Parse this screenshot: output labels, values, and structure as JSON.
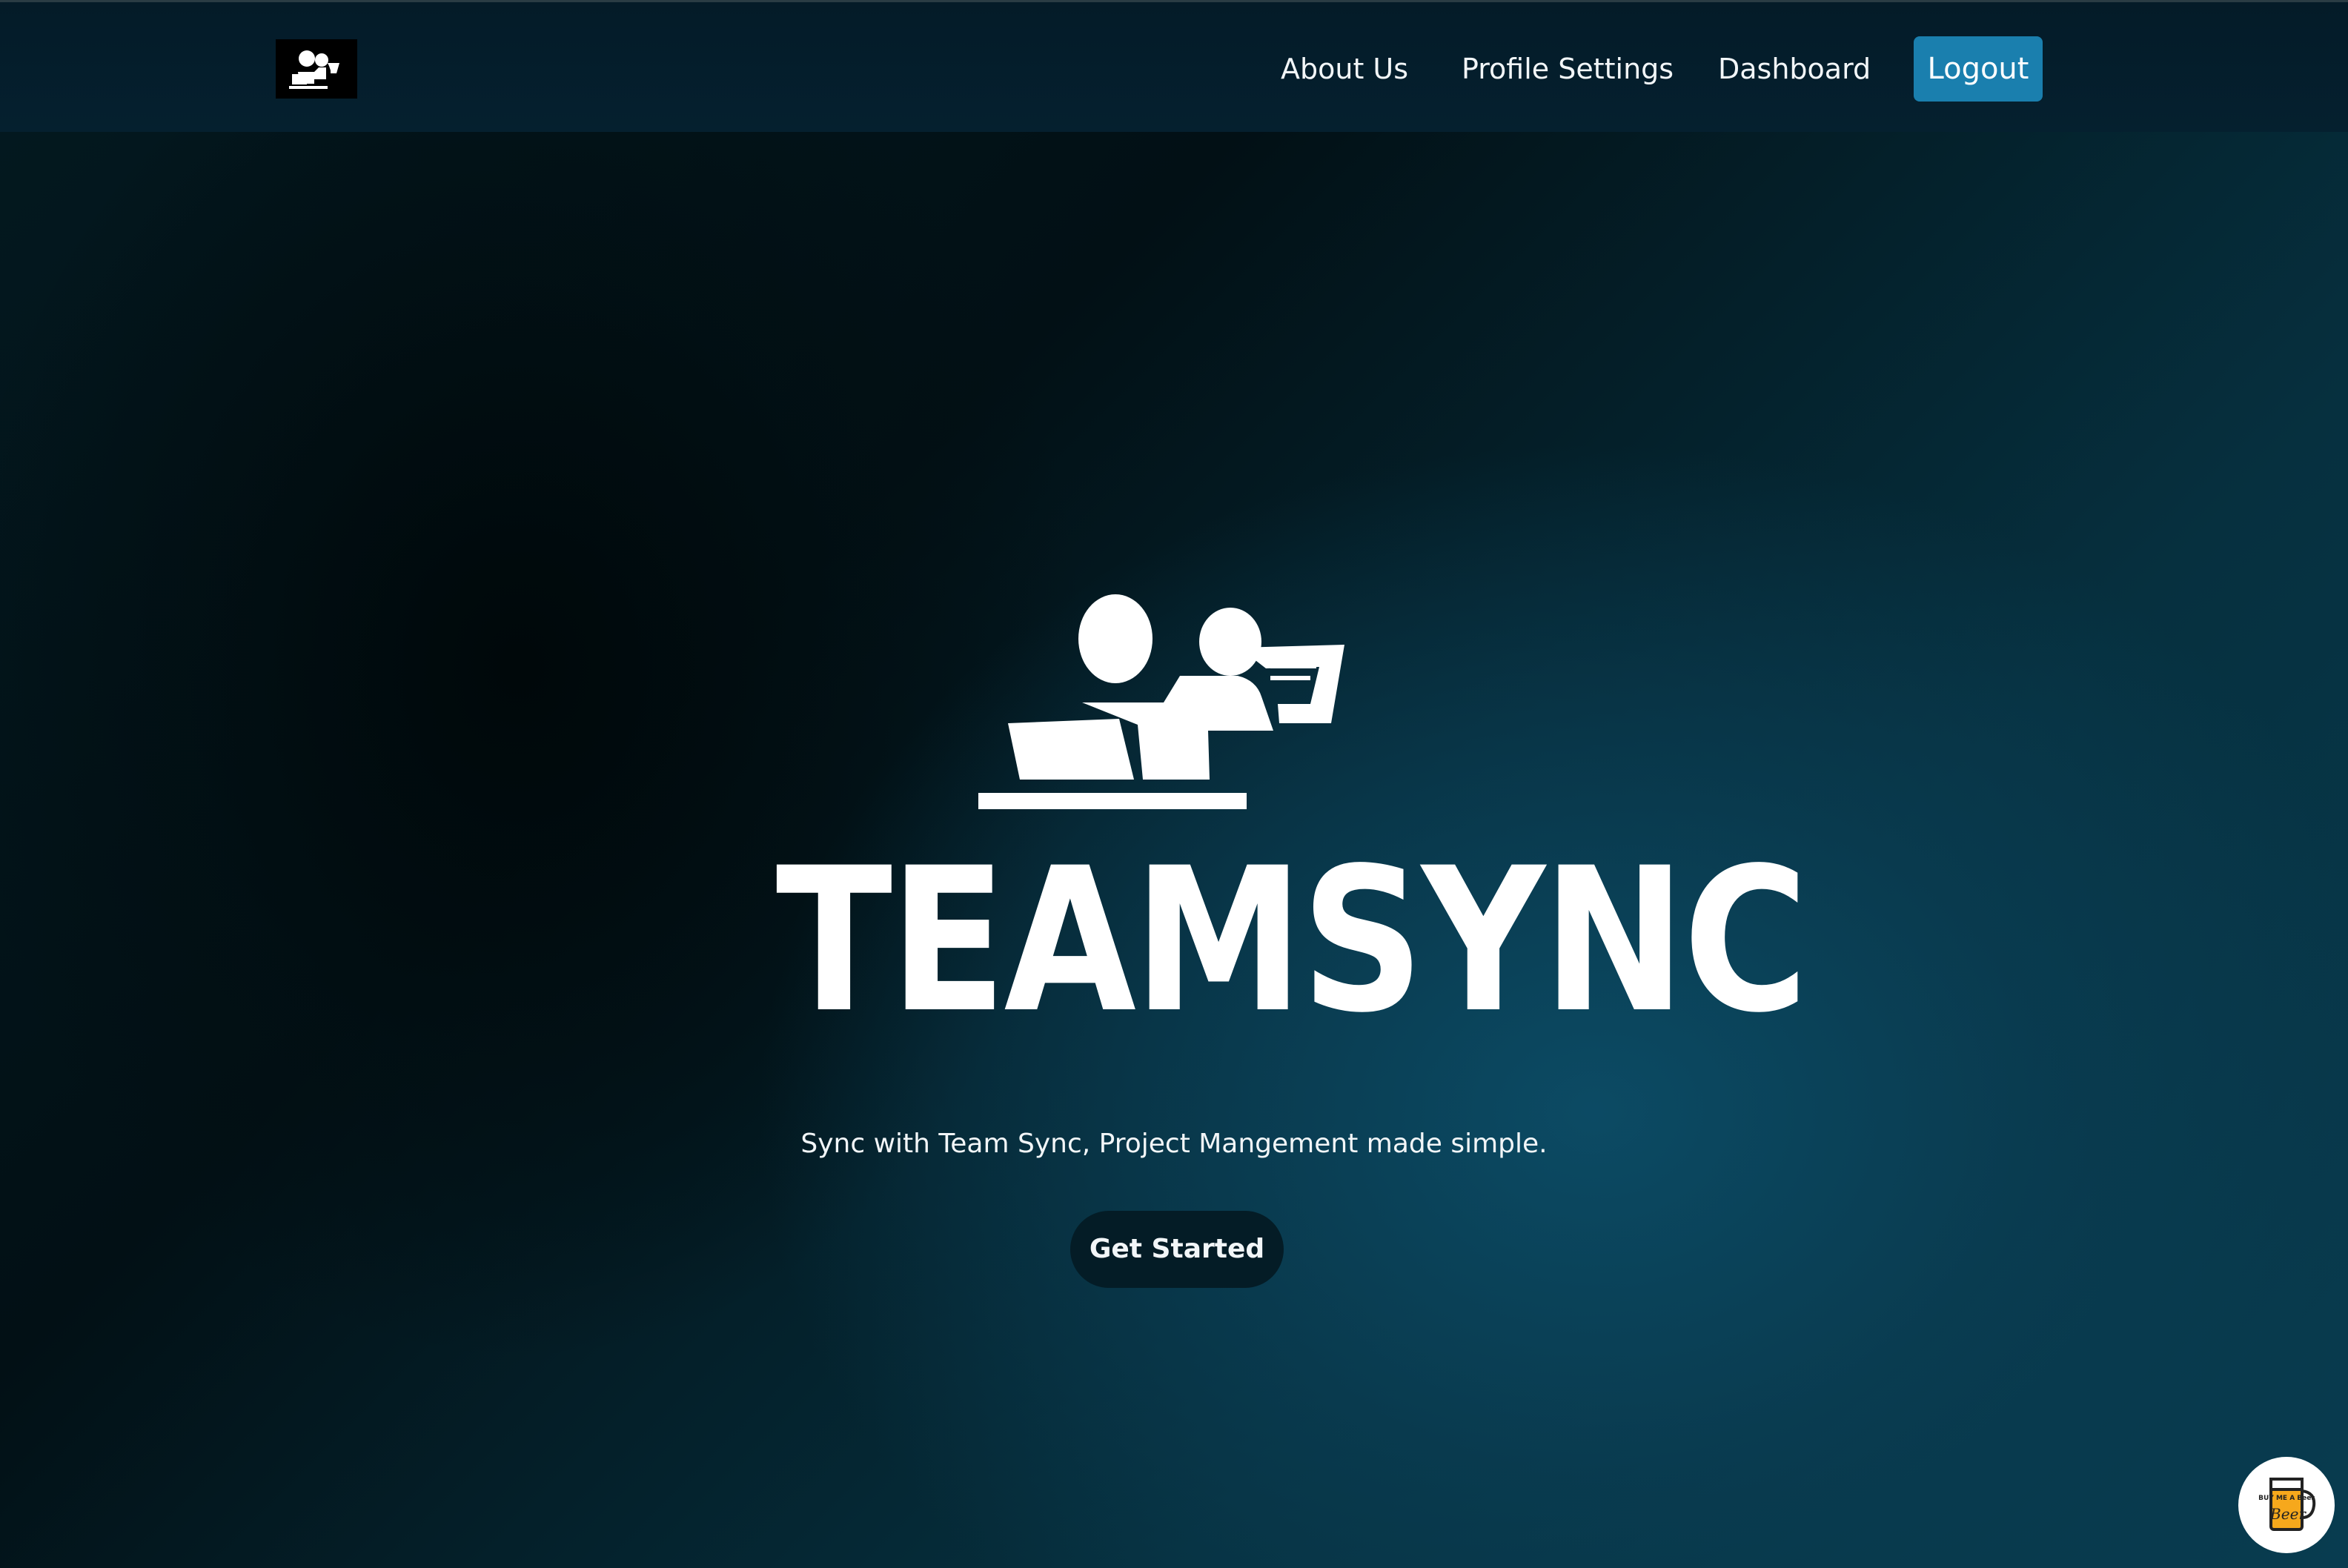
{
  "nav": {
    "logo_icon": "team-desk-icon",
    "links": [
      {
        "label": "About Us"
      },
      {
        "label": "Profile Settings"
      },
      {
        "label": "Dashboard"
      }
    ],
    "logout_label": "Logout"
  },
  "hero": {
    "logo_icon": "team-desk-icon",
    "wordmark": "TEAMSYNC",
    "tagline": "Sync with Team Sync, Project Mangement made simple.",
    "cta_label": "Get Started"
  },
  "floating": {
    "icon": "buy-me-a-beer-icon",
    "text": "BUY ME A Beer"
  },
  "colors": {
    "nav_bg": "#041b28",
    "logout_bg": "#1a7fae",
    "cta_bg": "#041c26",
    "text": "#f2f6f8"
  }
}
